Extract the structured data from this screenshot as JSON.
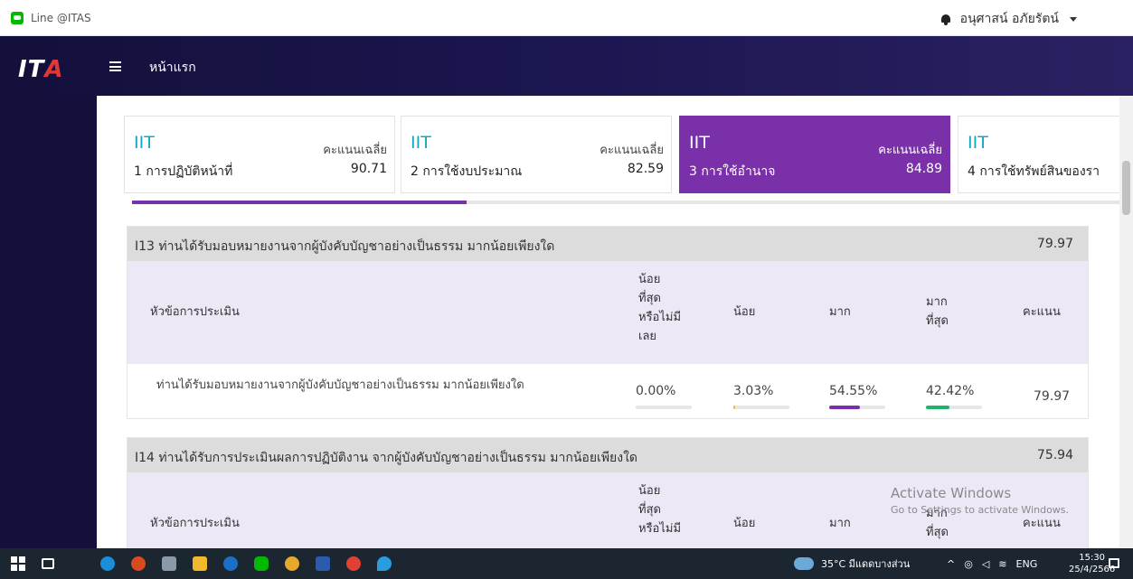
{
  "topbar": {
    "line_label": "Line @ITAS",
    "user_name": "อนุศาสน์ อภัยรัตน์"
  },
  "navbar": {
    "logo_text": "IT",
    "logo_accent": "A",
    "page_title": "หน้าแรก"
  },
  "cards": [
    {
      "iit": "IIT",
      "score_label": "คะแนนเฉลี่ย",
      "name": "1 การปฏิบัติหน้าที่",
      "score": "90.71"
    },
    {
      "iit": "IIT",
      "score_label": "คะแนนเฉลี่ย",
      "name": "2 การใช้งบประมาณ",
      "score": "82.59"
    },
    {
      "iit": "IIT",
      "score_label": "คะแนนเฉลี่ย",
      "name": "3 การใช้อำนาจ",
      "score": "84.89"
    },
    {
      "iit": "IIT",
      "score_label": "",
      "name": "4 การใช้ทรัพย์สินของรา",
      "score": ""
    }
  ],
  "table_headers": {
    "topic": "หัวข้อการประเมิน",
    "least_1": "น้อย",
    "least_2": "ที่สุด",
    "least_3": "หรือไม่มี",
    "least_4": "เลย",
    "less": "น้อย",
    "much": "มาก",
    "most_1": "มาก",
    "most_2": "ที่สุด",
    "score": "คะแนน"
  },
  "sections": [
    {
      "question": "I13 ท่านได้รับมอบหมายงานจากผู้บังคับบัญชาอย่างเป็นธรรม มากน้อยเพียงใด",
      "value": "79.97",
      "row": {
        "text": "ท่านได้รับมอบหมายงานจากผู้บังคับบัญชาอย่างเป็นธรรม มากน้อยเพียงใด",
        "p_least": "0.00%",
        "p_less": "3.03%",
        "p_much": "54.55%",
        "p_most": "42.42%",
        "score": "79.97",
        "fractions": [
          0.0,
          0.0303,
          0.5455,
          0.4242
        ]
      }
    },
    {
      "question": "I14 ท่านได้รับการประเมินผลการปฏิบัติงาน จากผู้บังคับบัญชาอย่างเป็นธรรม มากน้อยเพียงใด",
      "value": "75.94"
    }
  ],
  "watermark": {
    "line1": "Activate Windows",
    "line2": "Go to Settings to activate Windows."
  },
  "taskbar": {
    "weather": "35°C มีแดดบางส่วน",
    "lang": "ENG",
    "time": "15:30",
    "date": "25/4/2566"
  },
  "colors": {
    "accent_purple": "#7a30a8",
    "accent_teal": "#12a8c4",
    "bar_yellow": "#e8c12a",
    "bar_green": "#1fb36b"
  }
}
